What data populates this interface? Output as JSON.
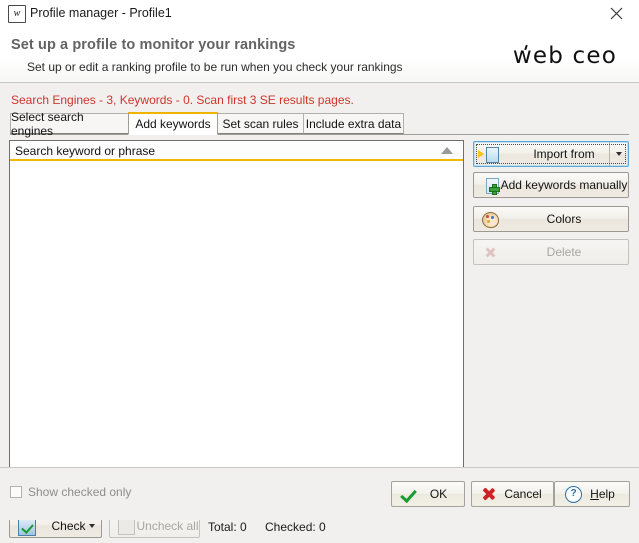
{
  "window": {
    "title": "Profile manager - Profile1",
    "icon_letter": "w",
    "close_label": "Close"
  },
  "banner": {
    "title": "Set up a profile to monitor your rankings",
    "subtitle": "Set up or edit a ranking profile to be run when you check your rankings",
    "brand": "web ceo"
  },
  "status": {
    "text": "Search Engines - 3, Keywords - 0. Scan first 3 SE results pages.",
    "color": "#d0342c"
  },
  "tabs": [
    {
      "label": "Select search engines",
      "active": false
    },
    {
      "label": "Add keywords",
      "active": true
    },
    {
      "label": "Set scan rules",
      "active": false
    },
    {
      "label": "Include extra data",
      "active": false
    }
  ],
  "list": {
    "column_header": "Search keyword or phrase",
    "sort": "ascending",
    "rows": [],
    "accent_color": "#f3b700"
  },
  "side_buttons": [
    {
      "label": "Import from",
      "icon": "import-document-icon",
      "enabled": true,
      "focused": true,
      "has_dropdown": true
    },
    {
      "label": "Add keywords manually",
      "icon": "document-add-icon",
      "enabled": true,
      "focused": false,
      "has_dropdown": false
    },
    {
      "label": "Colors",
      "icon": "palette-icon",
      "enabled": true,
      "focused": false,
      "has_dropdown": false
    },
    {
      "label": "Delete",
      "icon": "delete-icon",
      "enabled": false,
      "focused": false,
      "has_dropdown": false
    }
  ],
  "toolbar": {
    "check_label": "Check",
    "uncheck_label": "Uncheck all",
    "uncheck_enabled": false,
    "total_label": "Total: 0",
    "checked_label": "Checked: 0"
  },
  "footer": {
    "show_checked_label": "Show checked only",
    "show_checked_value": false,
    "ok_label": "OK",
    "cancel_label": "Cancel",
    "help_label_prefix": "H",
    "help_label_rest": "elp"
  }
}
